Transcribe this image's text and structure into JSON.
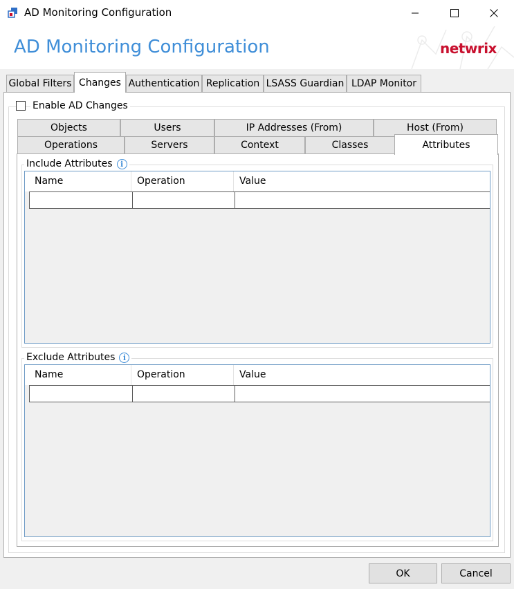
{
  "window": {
    "title": "AD Monitoring Configuration",
    "controls": [
      "minimize",
      "maximize",
      "close"
    ]
  },
  "header": {
    "title": "AD Monitoring Configuration",
    "brand": "netwrix",
    "brand_color": "#c8102e",
    "title_color": "#3f8ed8"
  },
  "top_tabs": [
    {
      "label": "Global Filters",
      "active": false
    },
    {
      "label": "Changes",
      "active": true
    },
    {
      "label": "Authentication",
      "active": false
    },
    {
      "label": "Replication",
      "active": false
    },
    {
      "label": "LSASS Guardian",
      "active": false
    },
    {
      "label": "LDAP Monitor",
      "active": false
    }
  ],
  "enable": {
    "label": "Enable AD Changes",
    "checked": false
  },
  "inner_tabs_row1": [
    {
      "label": "Objects"
    },
    {
      "label": "Users"
    },
    {
      "label": "IP Addresses (From)"
    },
    {
      "label": "Host (From)"
    }
  ],
  "inner_tabs_row2": [
    {
      "label": "Operations"
    },
    {
      "label": "Servers"
    },
    {
      "label": "Context"
    },
    {
      "label": "Classes"
    },
    {
      "label": "Attributes",
      "active": true
    }
  ],
  "include": {
    "title": "Include Attributes",
    "columns": [
      "Name",
      "Operation",
      "Value"
    ],
    "rows": []
  },
  "exclude": {
    "title": "Exclude Attributes",
    "columns": [
      "Name",
      "Operation",
      "Value"
    ],
    "rows": []
  },
  "buttons": {
    "ok": "OK",
    "cancel": "Cancel"
  }
}
